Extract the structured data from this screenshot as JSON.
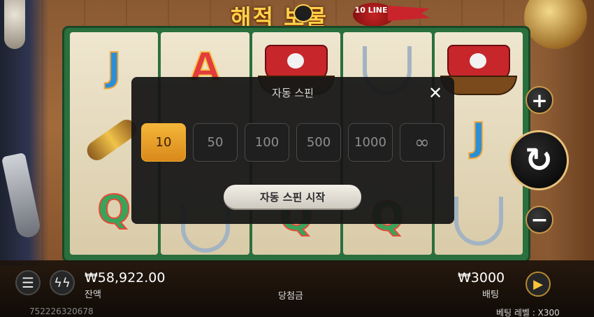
{
  "title": {
    "korean": "해적 보물",
    "lines_badge": "10 LINES"
  },
  "modal": {
    "title": "자동 스핀",
    "close_icon": "close-icon",
    "options": [
      "10",
      "50",
      "100",
      "500",
      "1000",
      "∞"
    ],
    "selected_option": "10",
    "start_label": "자동 스핀 시작"
  },
  "bottom_bar": {
    "balance": "₩58,922.00",
    "balance_label": "잔액",
    "win_label": "당첨금",
    "bet": "₩3000",
    "bet_label": "배팅",
    "session_id": "752226320678",
    "bet_level_label": "베팅 레벨 : X300"
  },
  "controls": {
    "plus_icon": "plus-icon",
    "minus_icon": "minus-icon",
    "spin_icon": "spin-icon",
    "menu_icon": "menu-icon",
    "turbo_icon": "turbo-icon",
    "autoplay_icon": "autoplay-icon"
  },
  "reel_symbols": [
    [
      "J",
      "spyglass",
      "Q"
    ],
    [
      "A",
      "",
      "anchor"
    ],
    [
      "ship",
      "",
      "Q"
    ],
    [
      "anchor",
      "",
      "Q"
    ],
    [
      "ship",
      "J",
      "anchor"
    ]
  ],
  "colors": {
    "selected_option_bg": "#f4b63a",
    "modal_bg": "#161616",
    "board_green": "#2a6f3e"
  }
}
